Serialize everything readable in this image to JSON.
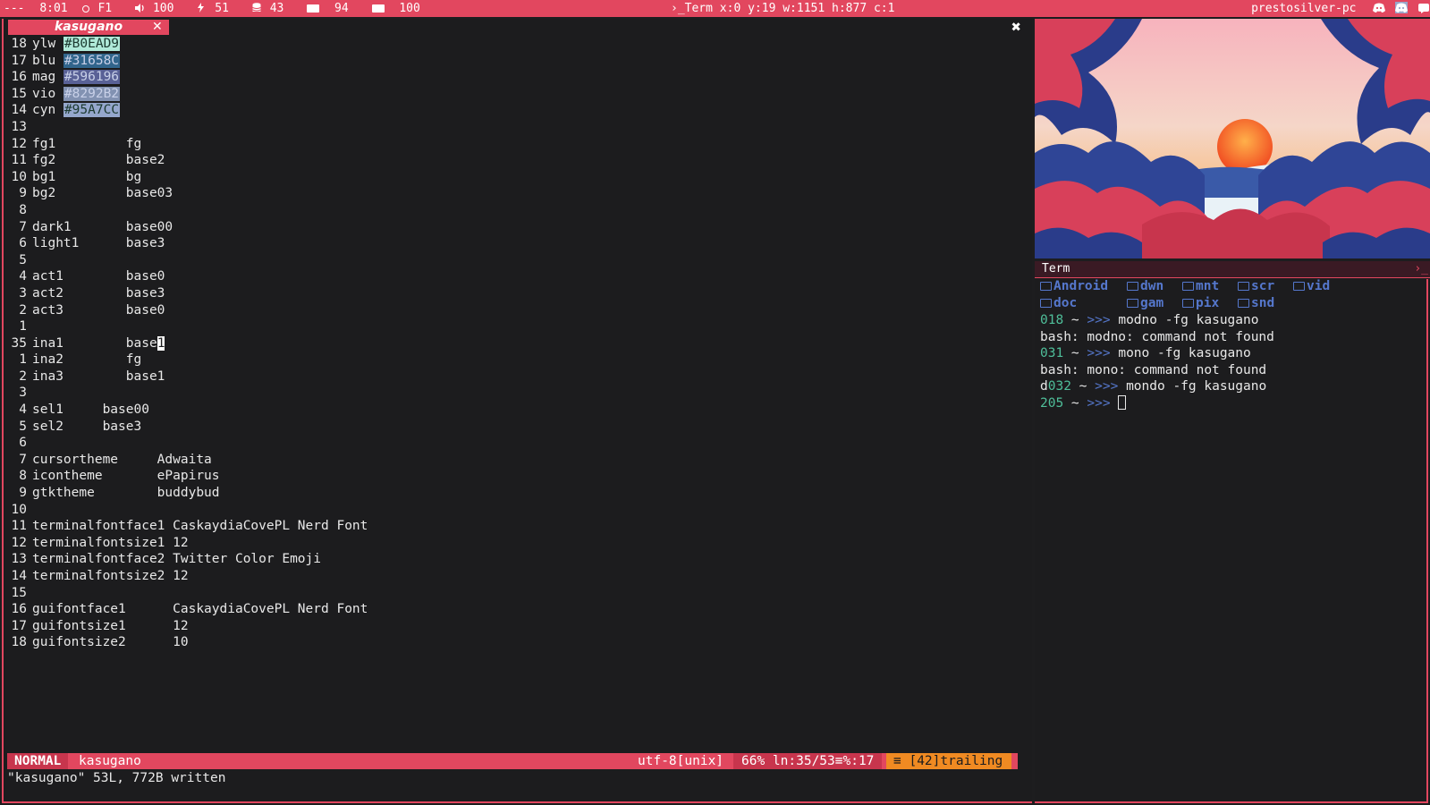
{
  "topbar": {
    "workspaces": "---",
    "time": "8:01",
    "wifi": "F1",
    "volume": "100",
    "brightness": "51",
    "disk": "43",
    "battery1": "94",
    "battery2": "100",
    "window_info": "Term x:0 y:19 w:1151 h:877 c:1",
    "hostname": "prestosilver-pc"
  },
  "editor": {
    "tab_title": "kasugano",
    "tab_close": "✕",
    "window_close": "✖",
    "lines": [
      {
        "n": "18",
        "text": "ylw ",
        "color": "#B0EAD9",
        "bg": "#B0EAD9"
      },
      {
        "n": "17",
        "text": "blu ",
        "color": "#31658C",
        "bg": "#31658C"
      },
      {
        "n": "16",
        "text": "mag ",
        "color": "#596196",
        "bg": "#596196"
      },
      {
        "n": "15",
        "text": "vio ",
        "color": "#8292B2",
        "bg": "#8292B2"
      },
      {
        "n": "14",
        "text": "cyn ",
        "color": "#95A7CC",
        "bg": "#95A7CC"
      },
      {
        "n": "13",
        "text": ""
      },
      {
        "n": "12",
        "text": "fg1         fg"
      },
      {
        "n": "11",
        "text": "fg2         base2"
      },
      {
        "n": "10",
        "text": "bg1         bg"
      },
      {
        "n": "9",
        "text": "bg2         base03"
      },
      {
        "n": "8",
        "text": ""
      },
      {
        "n": "7",
        "text": "dark1       base00"
      },
      {
        "n": "6",
        "text": "light1      base3"
      },
      {
        "n": "5",
        "text": ""
      },
      {
        "n": "4",
        "text": "act1        base0"
      },
      {
        "n": "3",
        "text": "act2        base3"
      },
      {
        "n": "2",
        "text": "act3        base0"
      },
      {
        "n": "1",
        "text": ""
      },
      {
        "n": "35",
        "text": "ina1        base",
        "cursor": "1"
      },
      {
        "n": "1",
        "text": "ina2        fg"
      },
      {
        "n": "2",
        "text": "ina3        base1"
      },
      {
        "n": "3",
        "text": ""
      },
      {
        "n": "4",
        "text": "sel1     base00"
      },
      {
        "n": "5",
        "text": "sel2     base3"
      },
      {
        "n": "6",
        "text": ""
      },
      {
        "n": "7",
        "text": "cursortheme     Adwaita"
      },
      {
        "n": "8",
        "text": "icontheme       ePapirus"
      },
      {
        "n": "9",
        "text": "gtktheme        buddybud"
      },
      {
        "n": "10",
        "text": ""
      },
      {
        "n": "11",
        "text": "terminalfontface1 CaskaydiaCovePL Nerd Font"
      },
      {
        "n": "12",
        "text": "terminalfontsize1 12"
      },
      {
        "n": "13",
        "text": "terminalfontface2 Twitter Color Emoji"
      },
      {
        "n": "14",
        "text": "terminalfontsize2 12"
      },
      {
        "n": "15",
        "text": ""
      },
      {
        "n": "16",
        "text": "guifontface1      CaskaydiaCovePL Nerd Font"
      },
      {
        "n": "17",
        "text": "guifontsize1      12"
      },
      {
        "n": "18",
        "text": "guifontsize2      10"
      }
    ],
    "statusline": {
      "mode": "NORMAL",
      "filename": "kasugano",
      "encoding": "utf-8[unix]",
      "position": "66% ln:35/53≡%:17",
      "warning": "≡ [42]trailing"
    },
    "message": "\"kasugano\" 53L, 772B written"
  },
  "terminal": {
    "title": "Term",
    "prompt_icon": "›_",
    "dirs": [
      "Android",
      "dwn",
      "mnt",
      "scr",
      "vid",
      "doc",
      "gam",
      "pix",
      "snd"
    ],
    "lines": [
      {
        "num": "018",
        "rest": " ~ ",
        "arrow": ">>>",
        "cmd": " modno -fg kasugano"
      },
      {
        "plain": "bash: modno: command not found"
      },
      {
        "num": "031",
        "rest": " ~ ",
        "arrow": ">>>",
        "cmd": " mono -fg kasugano"
      },
      {
        "plain": "bash: mono: command not found"
      },
      {
        "prefix": "d",
        "num": "032",
        "rest": " ~ ",
        "arrow": ">>>",
        "cmd": " mondo -fg kasugano"
      },
      {
        "num": "205",
        "rest": " ~ ",
        "arrow": ">>>",
        "cmd": " "
      }
    ]
  },
  "colors": {
    "accent": "#e2475f",
    "accent_dark": "#c8354d",
    "warning": "#f08a22",
    "dir_blue": "#5577cc",
    "prompt_num": "#4fbf9a",
    "background": "#1c1c1e"
  }
}
